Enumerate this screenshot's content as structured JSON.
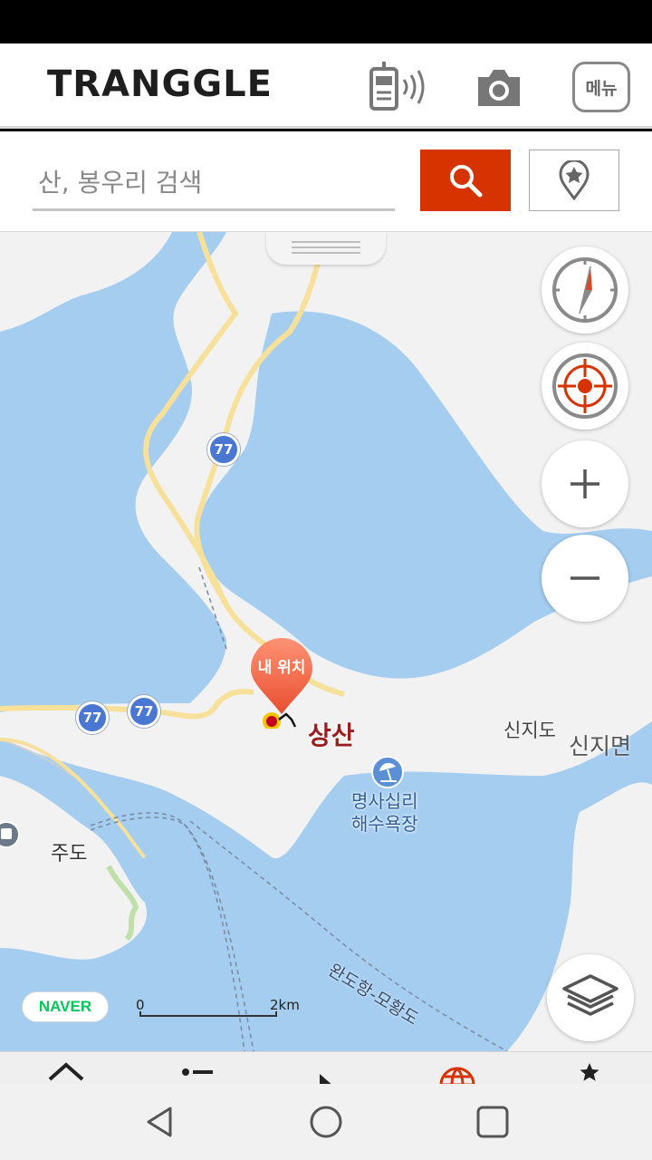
{
  "app": {
    "logo_text": "TRANGGLE",
    "menu_label": "메뉴",
    "icons": [
      "radio-icon",
      "camera-icon"
    ]
  },
  "search": {
    "placeholder": "산, 봉우리 검색",
    "value": ""
  },
  "map": {
    "my_location_label": "내 위치",
    "place_labels": {
      "sangsan": "상산",
      "sinjido": "신지도",
      "sinjimyeon": "신지면",
      "beach_line1": "명사십리",
      "beach_line2": "해수욕장",
      "judo": "주도",
      "ferry_route": "완도항-모황도"
    },
    "route_badges": [
      "77",
      "77",
      "77"
    ],
    "provider_logo": "NAVER",
    "scale": {
      "start": "0",
      "end": "2km"
    },
    "colors": {
      "water": "#a4cdf0",
      "land": "#f2f2f2",
      "road": "#f7e09a",
      "accent": "#d63300"
    }
  },
  "bottom_tabs": [
    "chevron-up-icon",
    "list-icon",
    "play-icon",
    "globe-icon",
    "star-icon"
  ],
  "system_nav": [
    "back-icon",
    "home-icon",
    "recents-icon"
  ]
}
